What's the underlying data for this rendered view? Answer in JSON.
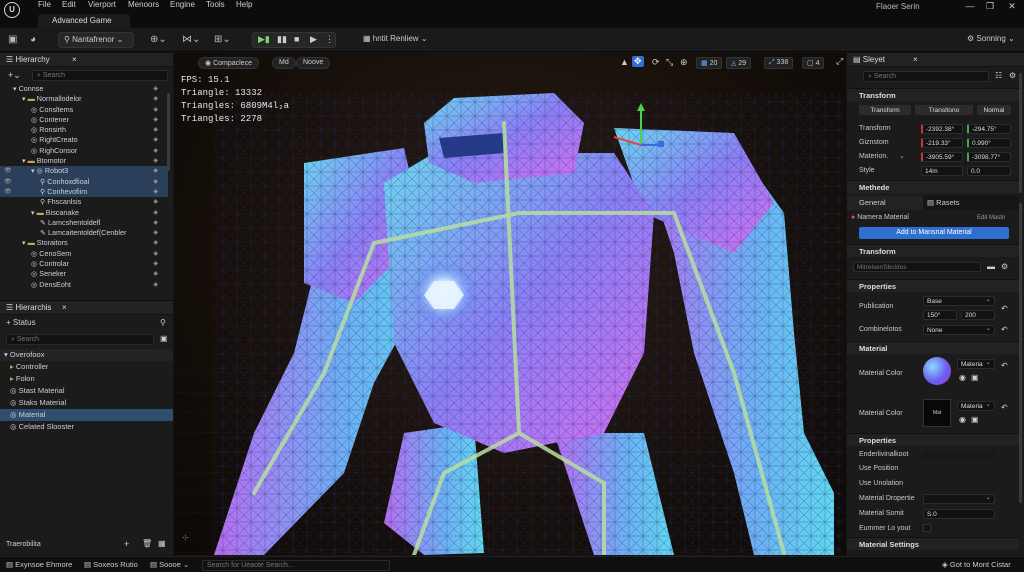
{
  "app": {
    "logo": "U",
    "tab_title": "Advanced Game",
    "window_title": "Flaoer Serin"
  },
  "menu": [
    "File",
    "Edit",
    "Vierport",
    "Menoors",
    "Engine",
    "Tools",
    "Help"
  ],
  "toolbar": {
    "mode_label": "Nantafrenor",
    "render_label": "hntit Renliew",
    "settings_label": "Sonning"
  },
  "hierarchy": {
    "title": "Hierarchy",
    "search_placeholder": "Search",
    "items": [
      {
        "label": "Connse",
        "indent": 1,
        "arrow": "▾",
        "icon": "",
        "selected": false
      },
      {
        "label": "Normallodelor",
        "indent": 2,
        "arrow": "▾",
        "icon": "folder",
        "selected": false
      },
      {
        "label": "Consltems",
        "indent": 3,
        "arrow": "",
        "icon": "obj",
        "selected": false
      },
      {
        "label": "Contener",
        "indent": 3,
        "arrow": "",
        "icon": "obj",
        "selected": false
      },
      {
        "label": "Ronsirth",
        "indent": 3,
        "arrow": "",
        "icon": "obj",
        "selected": false
      },
      {
        "label": "RightCreato",
        "indent": 3,
        "arrow": "",
        "icon": "obj",
        "selected": false
      },
      {
        "label": "RighConsor",
        "indent": 3,
        "arrow": "",
        "icon": "obj",
        "selected": false
      },
      {
        "label": "Btomotor",
        "indent": 2,
        "arrow": "▾",
        "icon": "folder",
        "selected": false
      },
      {
        "label": "Robot3",
        "indent": 3,
        "arrow": "▾",
        "icon": "obj",
        "selected": true
      },
      {
        "label": "Conhoxdfioal",
        "indent": 4,
        "arrow": "",
        "icon": "pin",
        "selected": true
      },
      {
        "label": "Conhevofiim",
        "indent": 4,
        "arrow": "",
        "icon": "pin",
        "selected": true
      },
      {
        "label": "Fhscanlsis",
        "indent": 4,
        "arrow": "",
        "icon": "pin",
        "selected": false
      },
      {
        "label": "Biscanake",
        "indent": 3,
        "arrow": "▾",
        "icon": "folder",
        "selected": false
      },
      {
        "label": "Lamcshentoldefl",
        "indent": 4,
        "arrow": "",
        "icon": "pen",
        "selected": false
      },
      {
        "label": "Lamcaitentoldef(Cenbler",
        "indent": 4,
        "arrow": "",
        "icon": "pen",
        "selected": false
      },
      {
        "label": "Storaitors",
        "indent": 2,
        "arrow": "▾",
        "icon": "folder",
        "selected": false
      },
      {
        "label": "CenoSem",
        "indent": 3,
        "arrow": "",
        "icon": "obj",
        "selected": false
      },
      {
        "label": "Controlar",
        "indent": 3,
        "arrow": "",
        "icon": "obj",
        "selected": false
      },
      {
        "label": "Seneker",
        "indent": 3,
        "arrow": "",
        "icon": "obj",
        "selected": false
      },
      {
        "label": "DensEoht",
        "indent": 3,
        "arrow": "",
        "icon": "obj",
        "selected": false
      }
    ]
  },
  "content": {
    "title": "Hierarchis",
    "status_label": "Status",
    "search_placeholder": "Search",
    "items": [
      {
        "label": "Overofoox",
        "icon": "▾",
        "selected": false,
        "header": true
      },
      {
        "label": "Controller",
        "icon": "▸",
        "selected": false,
        "header": false
      },
      {
        "label": "Folon",
        "icon": "▸",
        "selected": false,
        "header": false
      },
      {
        "label": "Stast Material",
        "icon": "◎",
        "selected": false,
        "header": false
      },
      {
        "label": "Staks Material",
        "icon": "◎",
        "selected": false,
        "header": false
      },
      {
        "label": "Material",
        "icon": "◎",
        "selected": true,
        "header": false
      },
      {
        "label": "Celated Slooster",
        "icon": "◎",
        "selected": false,
        "header": false
      }
    ],
    "footer_label": "Traerobilita"
  },
  "viewport": {
    "buttons": [
      "Compaclece",
      "Md",
      "Noove"
    ],
    "right_buttons": [
      "20",
      "29",
      "338",
      "4"
    ],
    "stats": [
      "FPS: 15.1",
      "Triangle: 13332",
      "Triangles: 6809M4l₂a",
      "Triangles: 2278"
    ]
  },
  "details": {
    "title": "Sleyet",
    "search_placeholder": "Search",
    "transform_section": "Transform",
    "transform_tabs": [
      "Transform",
      "Transltono",
      "Normal"
    ],
    "transform_rows": [
      {
        "label": "Transform",
        "v1": "-2392.38°",
        "v2": "-294.75°"
      },
      {
        "label": "Giznstom",
        "v1": "-219.33°",
        "v2": "0.990°"
      },
      {
        "label": "Materion.",
        "v1": "-3905.59°",
        "v2": "-3098.77°"
      }
    ],
    "style_label": "Style",
    "style_v1": "14m",
    "style_v2": "0.0",
    "methede_section": "Methede",
    "tab_general": "General",
    "tab_assets": "Rasets",
    "material_label": "Namera Material",
    "edit_label": "Edit Mastn",
    "add_button": "Add to Mansnal Material",
    "transform2_section": "Transform",
    "transform2_placeholder": "MitrelsenSbcidos",
    "properties_section": "Properties",
    "publication_label": "Publication",
    "publication_value": "Base",
    "pub_v1": "150°",
    "pub_v2": "200",
    "combin_label": "Combinelotos",
    "combin_value": "None",
    "material_section": "Material",
    "mat_color_label": "Material Color",
    "mat_slot_1": "Materia",
    "mat_slot_2": "Materia",
    "mat_thumb_text": "Mat",
    "properties2_section": "Properties",
    "prop_rows": [
      "Enderlivinalkoot",
      "Use Position",
      "Use Unolation",
      "Material Dropertie",
      "Material Somit",
      "Eummer Lo yout"
    ],
    "somit_value": "S.0",
    "material_settings_section": "Material Settings"
  },
  "statusbar": {
    "items": [
      "Exynsoe Ehmore",
      "Soxeos Rutio",
      "Soooe"
    ],
    "search_placeholder": "Search for Ueaote Search...",
    "right_label": "Got to Mont Cistar"
  },
  "colors": {
    "accent": "#2f6fd1",
    "selection": "#2a3f5a",
    "panel": "#1b1b1b"
  }
}
